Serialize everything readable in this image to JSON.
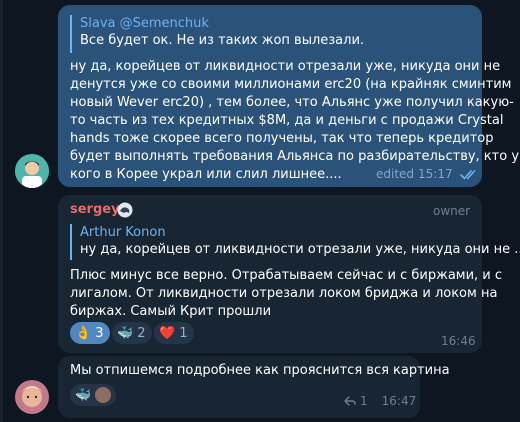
{
  "message1": {
    "reply_author": "Slava @Semenchuk",
    "reply_text": "Все будет ок. Не из таких жоп вылезали.",
    "lines": [
      "ну да, корейцев от ликвидности отрезали уже, никуда они не",
      "денутся уже со своими миллионами erc20 (на крайняк сминтим",
      "новый Wever erc20) , тем более, что Альянс уже получил какую-",
      "то часть из тех кредитных $8M, да и деньги    с продажи Crystal",
      "hands тоже скорее всего получены,  так что теперь кредитор",
      "будет выполнять  требования Альянса по разбирательству, кто у",
      "кого в Корее украл или слил лишнее...."
    ],
    "edited_label": "edited",
    "time": "15:17",
    "read_icon": "double-check-icon"
  },
  "message2": {
    "sender": "sergey",
    "sender_badge": "dragon-icon",
    "role": "owner",
    "reply_author": "Arthur Konon",
    "reply_text": "ну да, корейцев от ликвидности отрезали уже, никуда они не ...",
    "lines": [
      "Плюс минус все верно. Отрабатываем сейчас и с биржами, и с",
      "лигалом. От ликвидности отрезали локом бриджа и локом на",
      "биржах. Самый Крит прошли"
    ],
    "reactions": [
      {
        "emoji": "👌",
        "icon": "ok-hand-icon",
        "count": "3",
        "active": true
      },
      {
        "emoji": "🐳",
        "icon": "whale-icon",
        "count": "2",
        "active": false
      },
      {
        "emoji": "❤️",
        "icon": "heart-icon",
        "count": "1",
        "active": false
      }
    ],
    "time": "16:46"
  },
  "message3": {
    "text": "Мы отпишемся подробнее как прояснится вся картина",
    "reactions": [
      {
        "emoji": "🐳",
        "icon": "whale-icon"
      }
    ],
    "reply_count": "1",
    "reply_icon": "reply-arrow-icon",
    "time": "16:47"
  },
  "colors": {
    "background": "#0e1621",
    "own_bubble": "#2b5278",
    "incoming_bubble": "#182533",
    "accent": "#6ab3f3",
    "sender_name": "#e96a6a"
  }
}
